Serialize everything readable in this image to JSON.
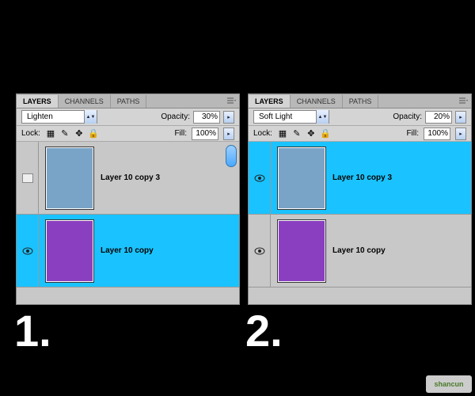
{
  "tabs": {
    "layers": "LAYERS",
    "channels": "CHANNELS",
    "paths": "PATHS"
  },
  "labels": {
    "opacity": "Opacity:",
    "lock": "Lock:",
    "fill": "Fill:"
  },
  "numbers": {
    "one": "1.",
    "two": "2."
  },
  "watermark": "shancun",
  "panel1": {
    "blend_mode": "Lighten",
    "opacity": "30%",
    "fill": "100%",
    "layers": [
      {
        "name": "Layer 10 copy 3",
        "color": "blue",
        "selected": false,
        "visible": false
      },
      {
        "name": "Layer 10 copy",
        "color": "purple",
        "selected": true,
        "visible": true
      }
    ]
  },
  "panel2": {
    "blend_mode": "Soft Light",
    "opacity": "20%",
    "fill": "100%",
    "layers": [
      {
        "name": "Layer 10 copy 3",
        "color": "blue",
        "selected": true,
        "visible": true
      },
      {
        "name": "Layer 10 copy",
        "color": "purple",
        "selected": false,
        "visible": true
      }
    ]
  }
}
